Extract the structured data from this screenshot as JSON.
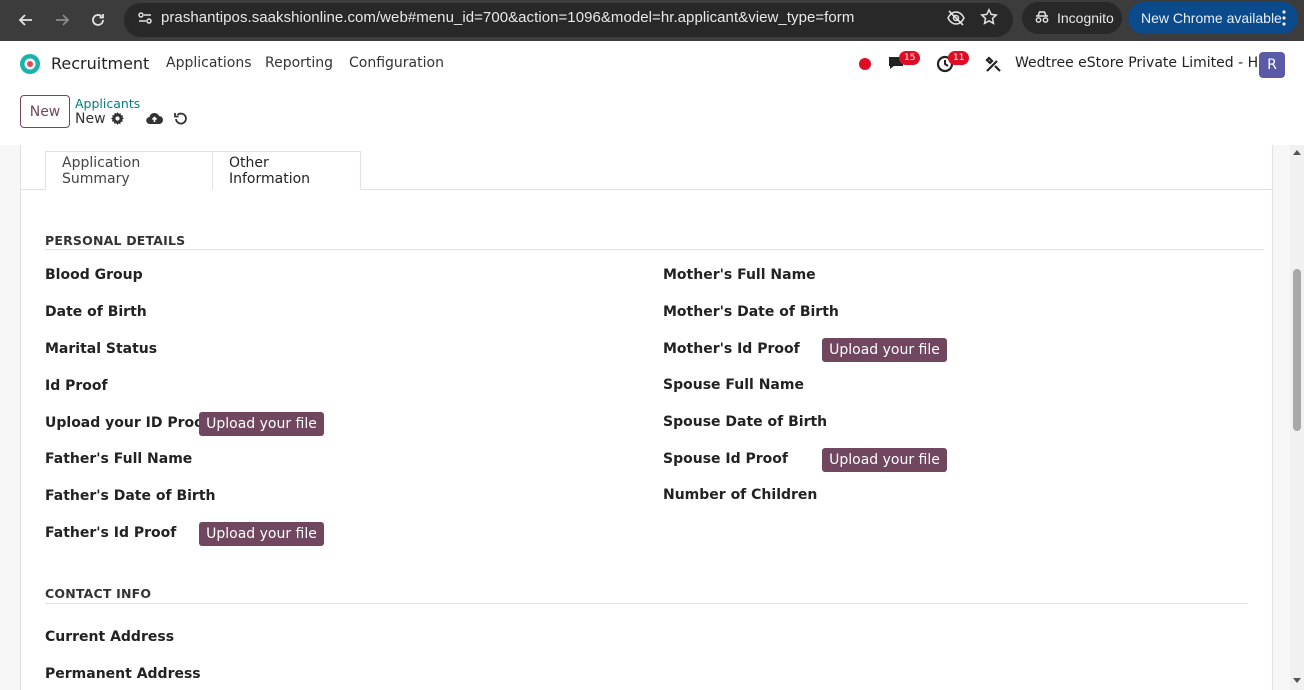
{
  "browser": {
    "url": "prashantipos.saakshionline.com/web#menu_id=700&action=1096&model=hr.applicant&view_type=form",
    "incognito_label": "Incognito",
    "update_label": "New Chrome available"
  },
  "topnav": {
    "app_name": "Recruitment",
    "menu": [
      "Applications",
      "Reporting",
      "Configuration"
    ],
    "messages_count": "15",
    "activities_count": "11",
    "company": "Wedtree eStore Private Limited - HO",
    "avatar_initial": "R",
    "colors": {
      "brand": "#71465f",
      "badge": "#e00c23",
      "avatar": "#5b5aa6"
    }
  },
  "control_panel": {
    "new_button": "New",
    "breadcrumb_parent": "Applicants",
    "breadcrumb_current": "New"
  },
  "tabs": [
    "Application Summary",
    "Other Information"
  ],
  "active_tab": "Other Information",
  "personal_details": {
    "title": "PERSONAL DETAILS",
    "left": {
      "blood_group": "Blood Group",
      "date_of_birth": "Date of Birth",
      "marital_status": "Marital Status",
      "id_proof": "Id Proof",
      "upload_id_proof": "Upload your ID Proof",
      "father_full_name": "Father's Full Name",
      "father_dob": "Father's Date of Birth",
      "father_id_proof": "Father's Id Proof"
    },
    "right": {
      "mother_full_name": "Mother's Full Name",
      "mother_dob": "Mother's Date of Birth",
      "mother_id_proof": "Mother's Id Proof",
      "spouse_full_name": "Spouse Full Name",
      "spouse_dob": "Spouse Date of Birth",
      "spouse_id_proof": "Spouse Id Proof",
      "number_of_children": "Number of Children"
    },
    "upload_label": "Upload your file"
  },
  "contact_info": {
    "title": "CONTACT INFO",
    "current_address": "Current Address",
    "permanent_address": "Permanent Address"
  }
}
